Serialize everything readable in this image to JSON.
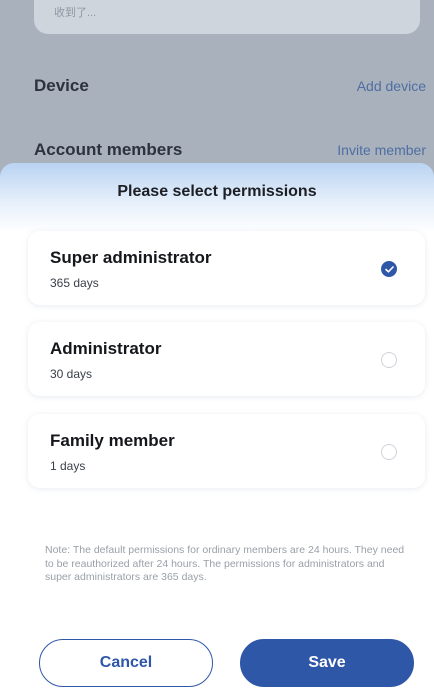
{
  "background": {
    "card_text": "收到了...",
    "device_label": "Device",
    "add_device": "Add device",
    "members_label": "Account members",
    "invite_member": "Invite member"
  },
  "sheet": {
    "title": "Please select permissions",
    "options": [
      {
        "name": "Super administrator",
        "duration": "365 days",
        "selected": true
      },
      {
        "name": "Administrator",
        "duration": "30 days",
        "selected": false
      },
      {
        "name": "Family member",
        "duration": "1 days",
        "selected": false
      }
    ],
    "note": "Note: The default permissions for ordinary members are 24 hours. They need to be reauthorized after 24 hours. The permissions for administrators and super administrators are 365 days.",
    "cancel_label": "Cancel",
    "save_label": "Save"
  },
  "colors": {
    "accent": "#2f57a8",
    "overlay": "#a9b1bd"
  }
}
